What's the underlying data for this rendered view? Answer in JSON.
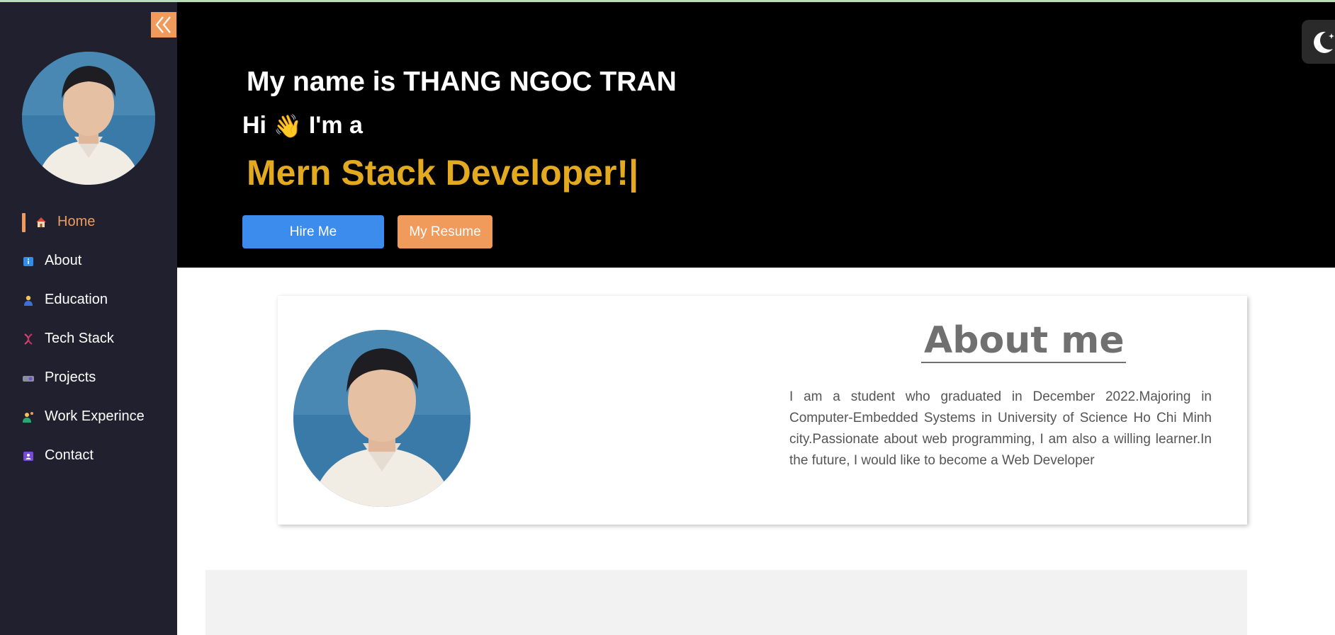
{
  "sidebar": {
    "collapse_icon": "double-chevron-left-icon",
    "items": [
      {
        "label": "Home",
        "icon": "house-icon",
        "active": true
      },
      {
        "label": "About",
        "icon": "info-icon"
      },
      {
        "label": "Education",
        "icon": "student-icon"
      },
      {
        "label": "Tech Stack",
        "icon": "dna-icon"
      },
      {
        "label": "Projects",
        "icon": "projector-icon"
      },
      {
        "label": "Work Experince",
        "icon": "worker-icon"
      },
      {
        "label": "Contact",
        "icon": "contact-card-icon"
      }
    ]
  },
  "hero": {
    "name": "My name is THANG NGOC TRAN",
    "hi": "Hi",
    "wave": "👋",
    "im_a": "I'm a",
    "role": "Mern Stack Developer!|",
    "hire_label": "Hire Me",
    "resume_label": "My Resume"
  },
  "about": {
    "title": "About me",
    "text": "I am a student who graduated in December 2022.Majoring in Computer-Embedded Systems in University of Science Ho Chi Minh city.Passionate about web programming, I am also a willing learner.In the future, I would like to become a Web Developer"
  },
  "theme_toggle": {
    "icon": "moon-stars-icon"
  },
  "colors": {
    "sidebar_bg": "#20202f",
    "accent": "#f09a5b",
    "hero_bg": "#000000",
    "role_color": "#e3aa1f",
    "hire_button": "#3b8ced"
  }
}
